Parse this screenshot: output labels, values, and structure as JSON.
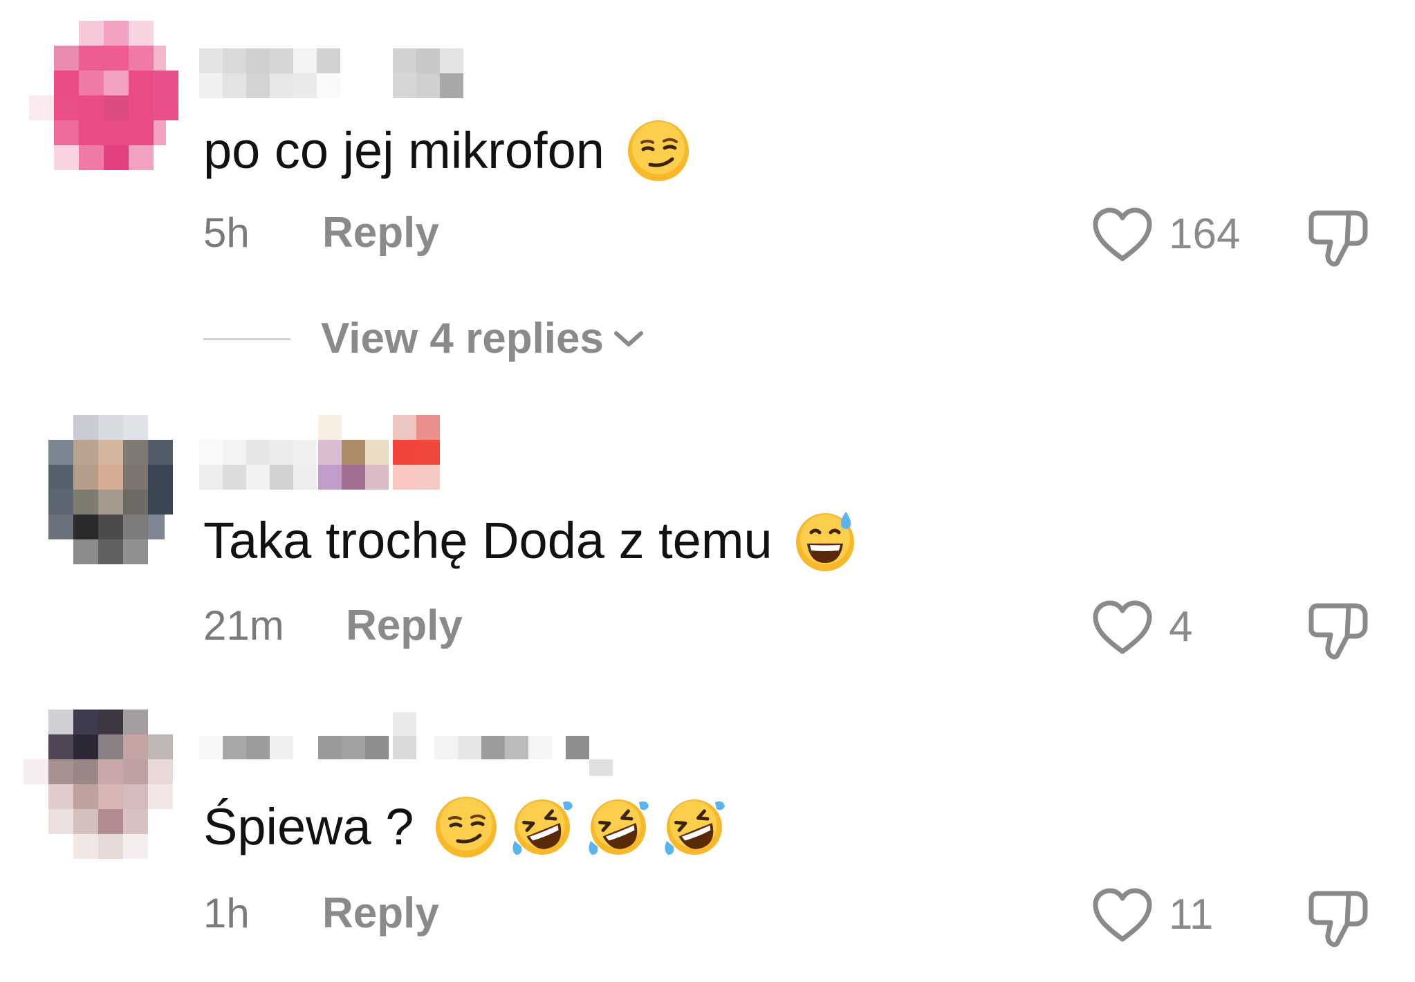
{
  "comments": [
    {
      "text": "po co jej mikrofon",
      "emojis": [
        "smirking-face"
      ],
      "time": "5h",
      "reply_label": "Reply",
      "likes": "164",
      "view_replies": "View 4 replies"
    },
    {
      "text": "Taka trochę Doda z temu",
      "emojis": [
        "grinning-sweat-face"
      ],
      "time": "21m",
      "reply_label": "Reply",
      "likes": "4"
    },
    {
      "text": "Śpiewa ?",
      "emojis": [
        "smirking-face",
        "rolling-laughing-face",
        "rolling-laughing-face",
        "rolling-laughing-face"
      ],
      "time": "1h",
      "reply_label": "Reply",
      "likes": "11"
    }
  ],
  "icons": {
    "like": "heart-outline-icon",
    "dislike": "thumbs-down-outline-icon",
    "expand": "chevron-down-icon"
  },
  "colors": {
    "text_primary": "#111111",
    "text_secondary": "#8a8a8a",
    "divider": "#d4d4d4",
    "emoji_yellow": "#f7b82a"
  }
}
